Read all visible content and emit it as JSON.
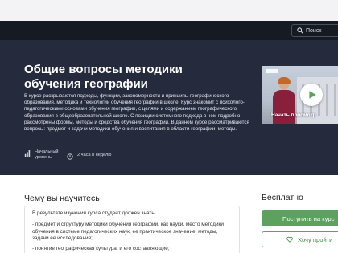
{
  "nav": {
    "search_label": "Поиск"
  },
  "course": {
    "title": "Общие вопросы методики обучения географии",
    "description": "В курсе раскрываются подходы, функции, закономерности и принципы географического образования, методика и технологии обучения географии в школе. Курс знакомит с психолого-педагогическими основами обучения географии, с целями и содержанием географического образования в общеобразовательной школе. С позиции системного подхода в нем подробно рассмотрены формы, методы и средства обучения географии. В данном курсе рассматриваются вопросы: предмет и задачи методики обучения и воспитания в области географии, методы.",
    "level_label": "Начальный уровень",
    "time_label": "2 часа в неделю",
    "video_label": "Начать просмотр"
  },
  "learn": {
    "title": "Чему вы научитесь",
    "lines": [
      "В результате изучения курса студент должен знать:",
      "- предмет и структуру методики обучения географии, как науки, место методики обучения в системе педагогических наук, ее практическое значение, методы, задачи ее исследования;",
      "- понятие географическая культура, и его составляющие;"
    ]
  },
  "sidebar": {
    "price": "Бесплатно",
    "enroll_label": "Поступить на курс",
    "wish_label": "Хочу пройти"
  },
  "colors": {
    "navbar": "#151a23",
    "hero": "#262a3d",
    "accent_green": "#5ca25e"
  },
  "icons": {
    "search": "search-icon",
    "level": "bar-chart-icon",
    "time": "clock-icon",
    "play": "play-icon",
    "wish": "heart-icon"
  }
}
